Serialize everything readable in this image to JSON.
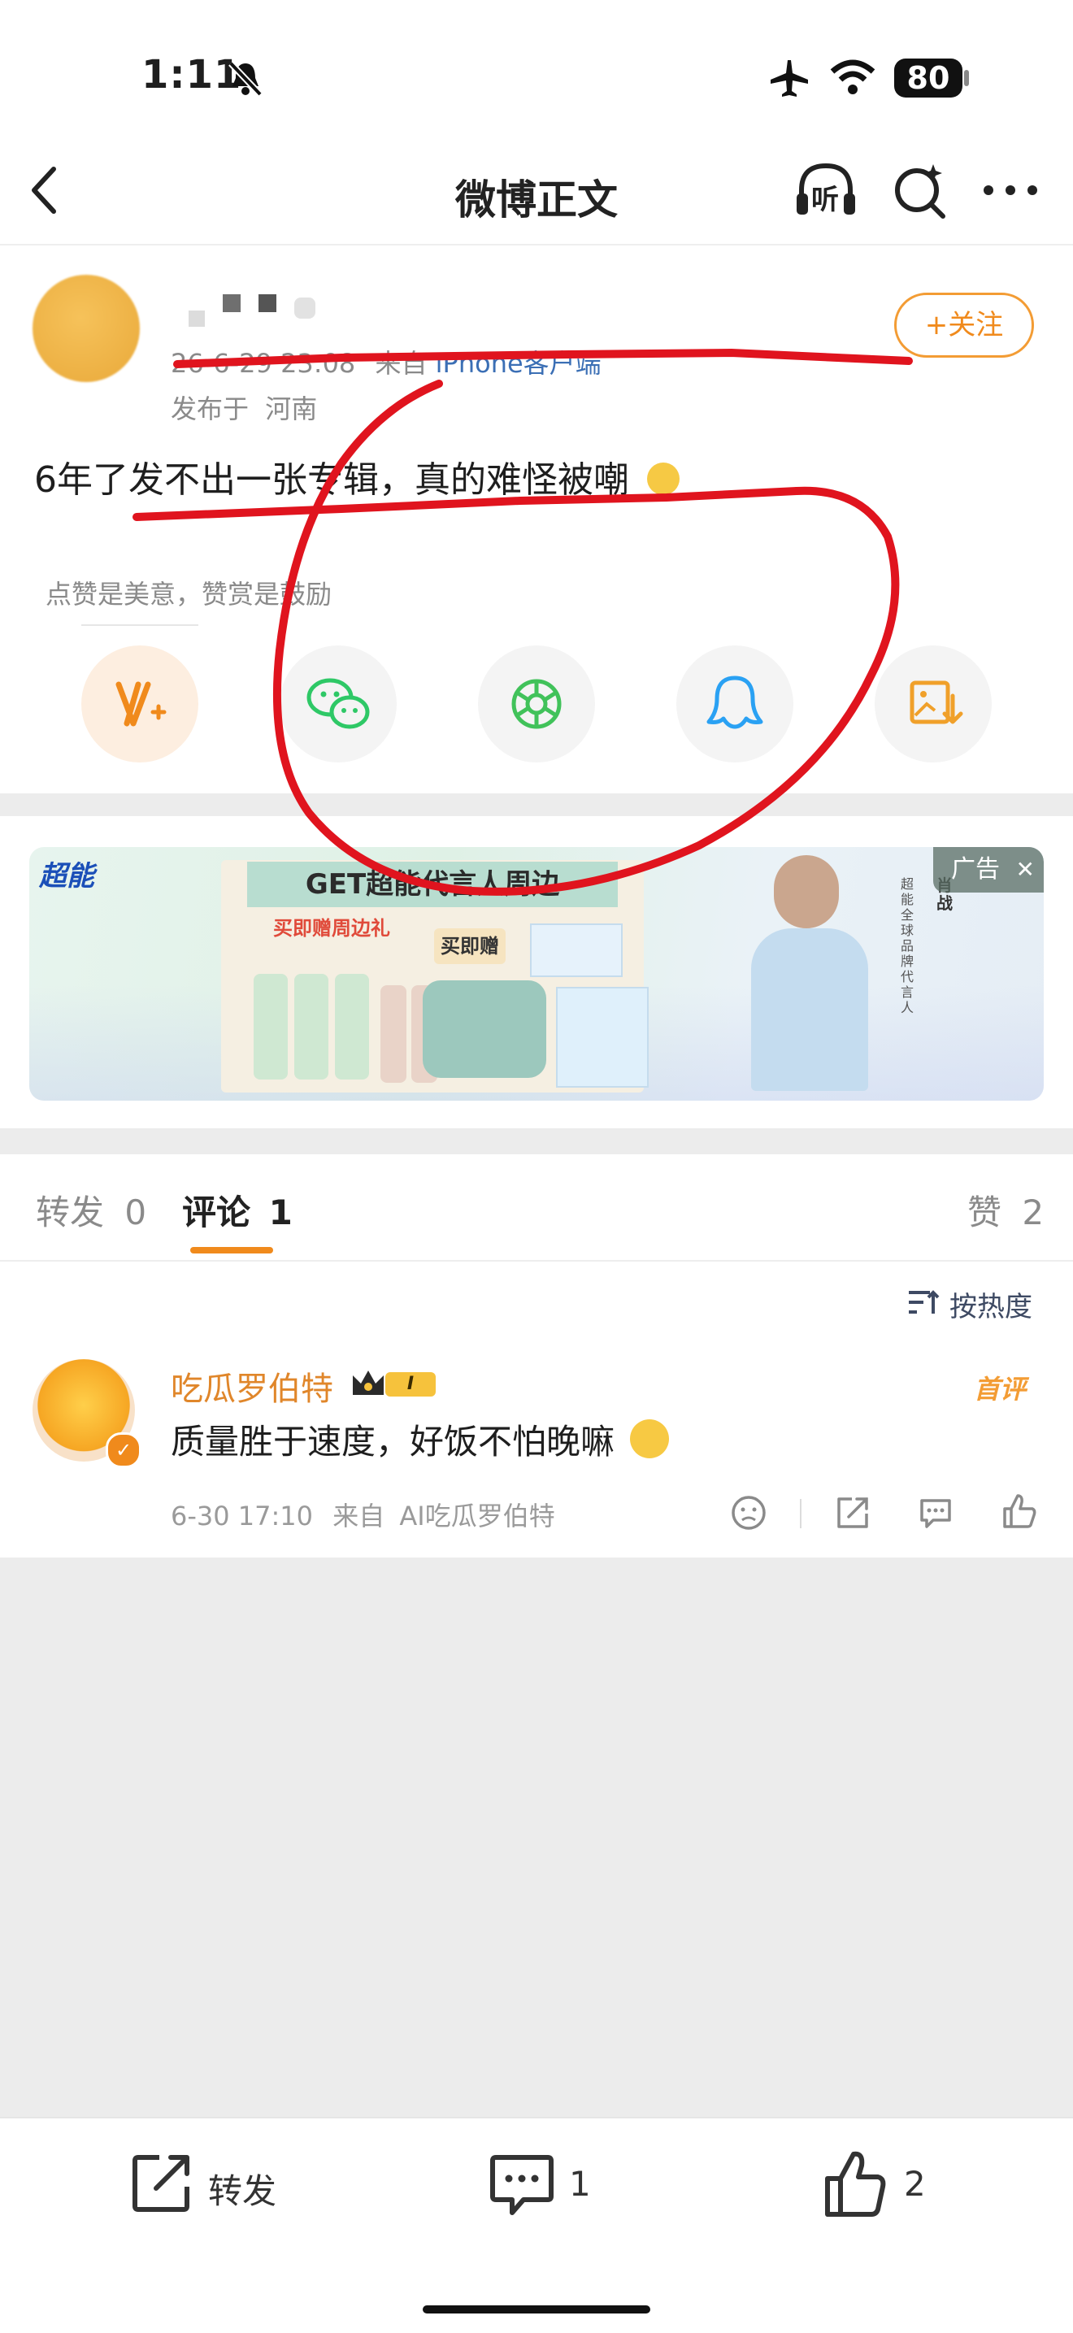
{
  "status_bar": {
    "time": "1:11",
    "battery": "80"
  },
  "nav": {
    "title": "微博正文",
    "listen_label": "听"
  },
  "post": {
    "author_name": "",
    "timestamp": "26-6-29 23:08",
    "source_prefix": "来自",
    "source": "iPhone客户端",
    "location_prefix": "发布于",
    "location": "河南",
    "follow_label": "+关注",
    "text": "6年了发不出一张专辑，真的难怪被嘲",
    "reward_hint": "点赞是美意，赞赏是鼓励"
  },
  "ad": {
    "badge": "广告",
    "brand": "超能",
    "headline": "GET超能代言人周边",
    "gift_line": "买即赠周边礼",
    "buy_label": "买即赠",
    "spokesperson": "肖战",
    "spokesperson_title": "超能全球品牌代言人"
  },
  "tabs": [
    {
      "label": "转发",
      "count": "0"
    },
    {
      "label": "评论",
      "count": "1"
    },
    {
      "label": "赞",
      "count": "2"
    }
  ],
  "sort_label": "按热度",
  "comments": [
    {
      "user": "吃瓜罗伯特",
      "level": "I",
      "tag": "首评",
      "text": "质量胜于速度，好饭不怕晚嘛",
      "time": "6-30 17:10",
      "source_prefix": "来自",
      "source": "AI吃瓜罗伯特"
    }
  ],
  "bottom_bar": {
    "repost_label": "转发",
    "comment_count": "1",
    "like_count": "2"
  },
  "colors": {
    "accent": "#f08a1c",
    "annotation": "#e0141e",
    "wechat": "#2ec866",
    "moments": "#41c25a",
    "qq": "#2aa1f3"
  }
}
